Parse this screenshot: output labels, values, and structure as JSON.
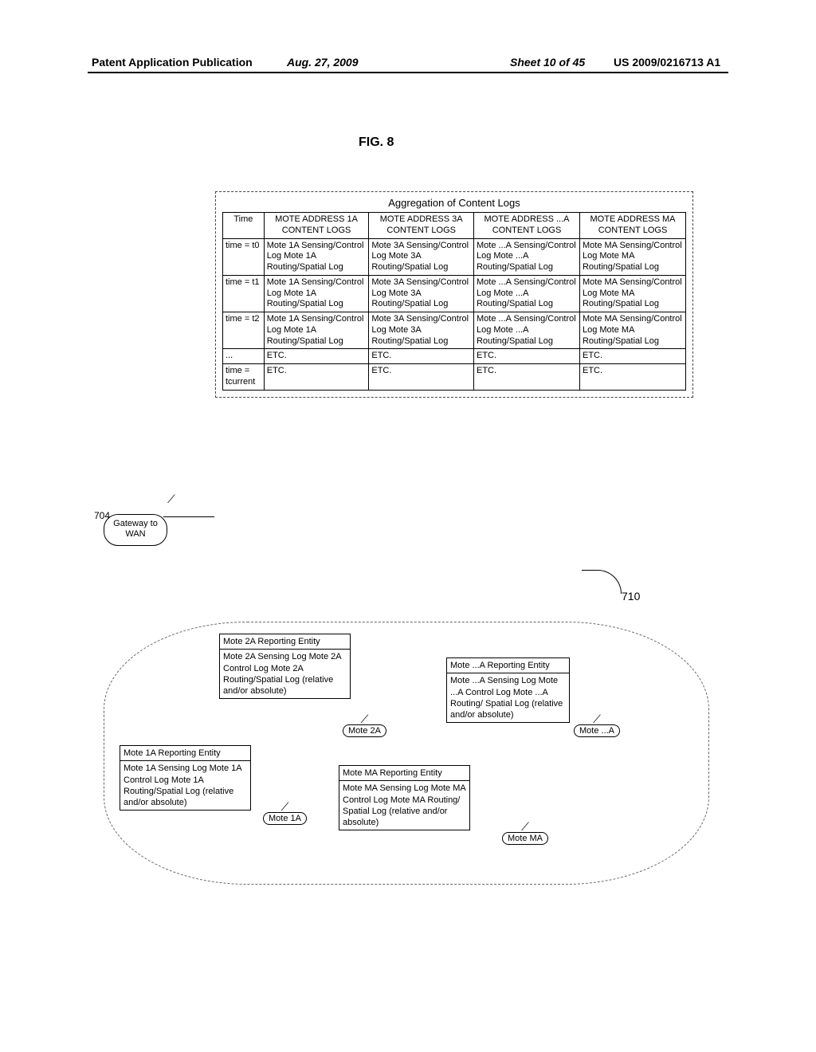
{
  "header": {
    "left": "Patent Application Publication",
    "center": "Aug. 27, 2009",
    "sheet": "Sheet 10 of 45",
    "right": "US 2009/0216713 A1"
  },
  "figure_title": "FIG. 8",
  "aggregation": {
    "title": "Aggregation of Content Logs",
    "columns": [
      "Time",
      "MOTE ADDRESS 1A CONTENT LOGS",
      "MOTE ADDRESS 3A CONTENT LOGS",
      "MOTE ADDRESS ...A CONTENT LOGS",
      "MOTE ADDRESS MA CONTENT LOGS"
    ],
    "rows": [
      {
        "time": "time = t0",
        "c1": "Mote 1A Sensing/Control Log\nMote 1A Routing/Spatial Log",
        "c2": "Mote 3A Sensing/Control Log\nMote 3A Routing/Spatial Log",
        "c3": "Mote ...A Sensing/Control Log\nMote ...A Routing/Spatial Log",
        "c4": "Mote MA Sensing/Control Log\nMote MA Routing/Spatial Log"
      },
      {
        "time": "time = t1",
        "c1": "Mote 1A Sensing/Control Log\nMote 1A Routing/Spatial Log",
        "c2": "Mote 3A Sensing/Control Log\nMote 3A Routing/Spatial Log",
        "c3": "Mote ...A Sensing/Control Log\nMote ...A Routing/Spatial Log",
        "c4": "Mote MA Sensing/Control Log\nMote MA Routing/Spatial Log"
      },
      {
        "time": "time = t2",
        "c1": "Mote 1A Sensing/Control Log\nMote 1A Routing/Spatial Log",
        "c2": "Mote 3A Sensing/Control Log\nMote 3A Routing/Spatial Log",
        "c3": "Mote ...A Sensing/Control Log\nMote ...A Routing/Spatial Log",
        "c4": "Mote MA Sensing/Control Log\nMote MA Routing/Spatial Log"
      },
      {
        "time": "...",
        "c1": "ETC.",
        "c2": "ETC.",
        "c3": "ETC.",
        "c4": "ETC."
      },
      {
        "time": "time = tcurrent",
        "c1": "ETC.",
        "c2": "ETC.",
        "c3": "ETC.",
        "c4": "ETC."
      }
    ]
  },
  "gateway": {
    "label": "Gateway to WAN",
    "ref": "704"
  },
  "ref710": "710",
  "motes": {
    "2a": {
      "header": "Mote 2A Reporting Entity",
      "body": "Mote 2A Sensing Log\nMote 2A Control Log\nMote 2A Routing/Spatial Log (relative and/or absolute)",
      "node": "Mote 2A"
    },
    "dota": {
      "header": "Mote ...A Reporting Entity",
      "body": "Mote ...A Sensing Log\nMote ...A Control Log\nMote ...A Routing/ Spatial Log (relative and/or absolute)",
      "node": "Mote ...A"
    },
    "1a": {
      "header": "Mote 1A Reporting Entity",
      "body": "Mote 1A Sensing Log\nMote 1A Control Log\nMote 1A Routing/Spatial Log (relative and/or absolute)",
      "node": "Mote 1A"
    },
    "ma": {
      "header": "Mote MA Reporting Entity",
      "body": "Mote MA Sensing Log\nMote MA Control Log\nMote MA Routing/ Spatial Log (relative and/or absolute)",
      "node": "Mote MA"
    }
  },
  "antenna_glyph": "⟋"
}
